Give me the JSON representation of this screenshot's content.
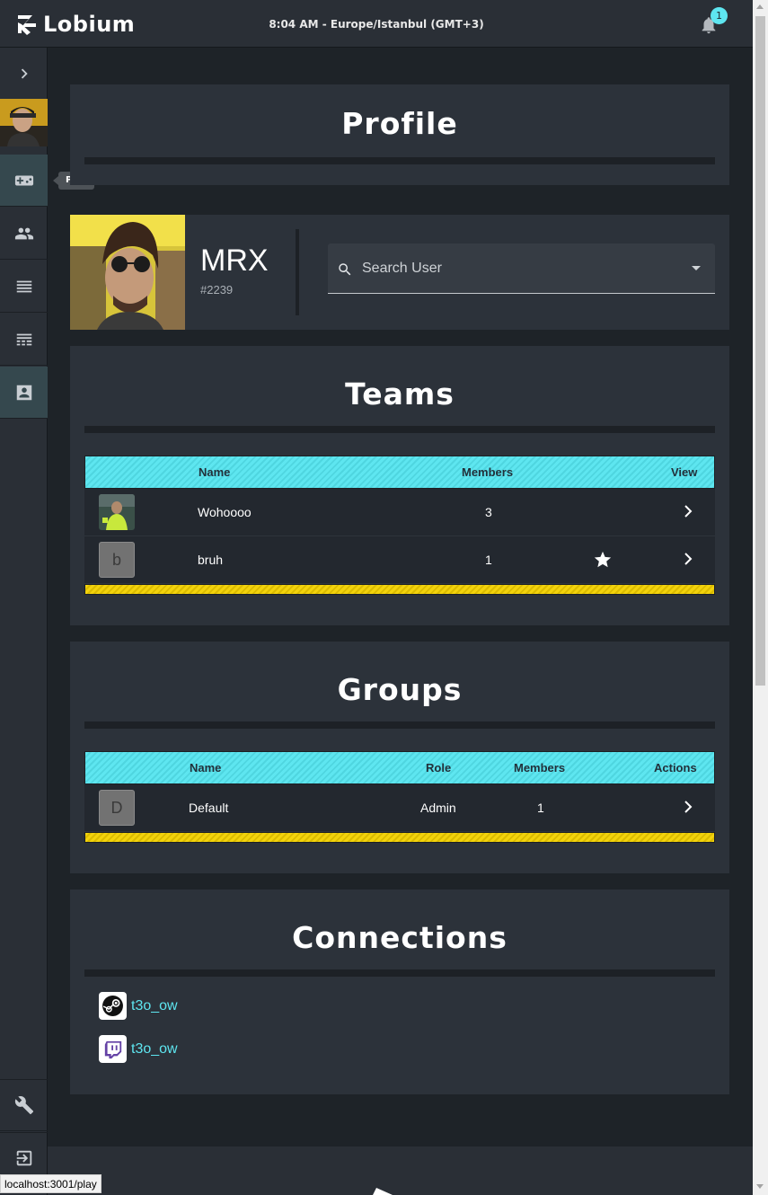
{
  "app": {
    "name": "Lobium",
    "clock": "8:04 AM - Europe/Istanbul (GMT+3)",
    "notification_count": "1"
  },
  "sidebar": {
    "tooltip": "Play",
    "items": [
      {
        "icon": "chevron-right-icon"
      },
      {
        "icon": "gamepad-icon",
        "active": true
      },
      {
        "icon": "people-icon"
      },
      {
        "icon": "list-icon"
      },
      {
        "icon": "table-icon"
      },
      {
        "icon": "contact-card-icon"
      },
      {
        "icon": "wrench-icon"
      },
      {
        "icon": "logout-icon"
      }
    ]
  },
  "profile": {
    "title": "Profile",
    "username": "MRX",
    "tag": "#2239",
    "search_placeholder": "Search User"
  },
  "teams": {
    "title": "Teams",
    "headers": {
      "name": "Name",
      "members": "Members",
      "view": "View"
    },
    "rows": [
      {
        "name": "Wohoooo",
        "members": "3",
        "avatar": "image",
        "favorite": false
      },
      {
        "name": "bruh",
        "members": "1",
        "avatar_letter": "b",
        "favorite": true
      }
    ]
  },
  "groups": {
    "title": "Groups",
    "headers": {
      "name": "Name",
      "role": "Role",
      "members": "Members",
      "actions": "Actions"
    },
    "rows": [
      {
        "name": "Default",
        "role": "Admin",
        "members": "1",
        "avatar_letter": "D"
      }
    ]
  },
  "connections": {
    "title": "Connections",
    "items": [
      {
        "service": "steam-icon",
        "label": "t3o_ow"
      },
      {
        "service": "twitch-icon",
        "label": "t3o_ow"
      }
    ]
  },
  "status_bar": {
    "url": "localhost:3001/play"
  },
  "colors": {
    "accent": "#5ee6f0",
    "footer_stripe": "#f3d30c",
    "panel": "#2c323a",
    "background": "#1e2328"
  }
}
